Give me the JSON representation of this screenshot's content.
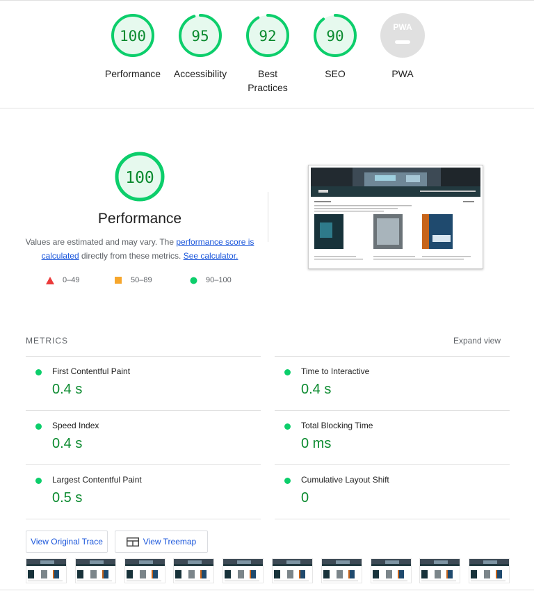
{
  "summary_gauges": [
    {
      "score": "100",
      "label_lines": [
        "Performance"
      ],
      "fraction": 1.0
    },
    {
      "score": "95",
      "label_lines": [
        "Accessibility"
      ],
      "fraction": 0.95
    },
    {
      "score": "92",
      "label_lines": [
        "Best",
        "Practices"
      ],
      "fraction": 0.92
    },
    {
      "score": "90",
      "label_lines": [
        "SEO"
      ],
      "fraction": 0.9
    },
    {
      "score": "PWA",
      "label_lines": [
        "PWA"
      ],
      "fraction": 0
    }
  ],
  "performance": {
    "score": "100",
    "title": "Performance",
    "desc_prefix": "Values are estimated and may vary. The ",
    "link_score": "performance score is calculated",
    "desc_mid": " directly from these metrics. ",
    "link_calc": "See calculator.",
    "legend": [
      {
        "range": "0–49",
        "shape": "triangle",
        "color": "#eb3b3b"
      },
      {
        "range": "50–89",
        "shape": "square",
        "color": "#f6a62c"
      },
      {
        "range": "90–100",
        "shape": "circle",
        "color": "#0cce6b"
      }
    ]
  },
  "metrics": {
    "title": "METRICS",
    "expand": "Expand view",
    "items": [
      {
        "name": "First Contentful Paint",
        "value": "0.4 s"
      },
      {
        "name": "Time to Interactive",
        "value": "0.4 s"
      },
      {
        "name": "Speed Index",
        "value": "0.4 s"
      },
      {
        "name": "Total Blocking Time",
        "value": "0 ms"
      },
      {
        "name": "Largest Contentful Paint",
        "value": "0.5 s"
      },
      {
        "name": "Cumulative Layout Shift",
        "value": "0"
      }
    ]
  },
  "buttons": {
    "original_trace": "View Original Trace",
    "treemap": "View Treemap"
  },
  "colors": {
    "pass": "#0cce6b",
    "pass_text": "#0a8a2e",
    "pass_bg": "#e6f9ee",
    "pwa_gray": "#e0e0e0"
  },
  "filmstrip_count": 10
}
